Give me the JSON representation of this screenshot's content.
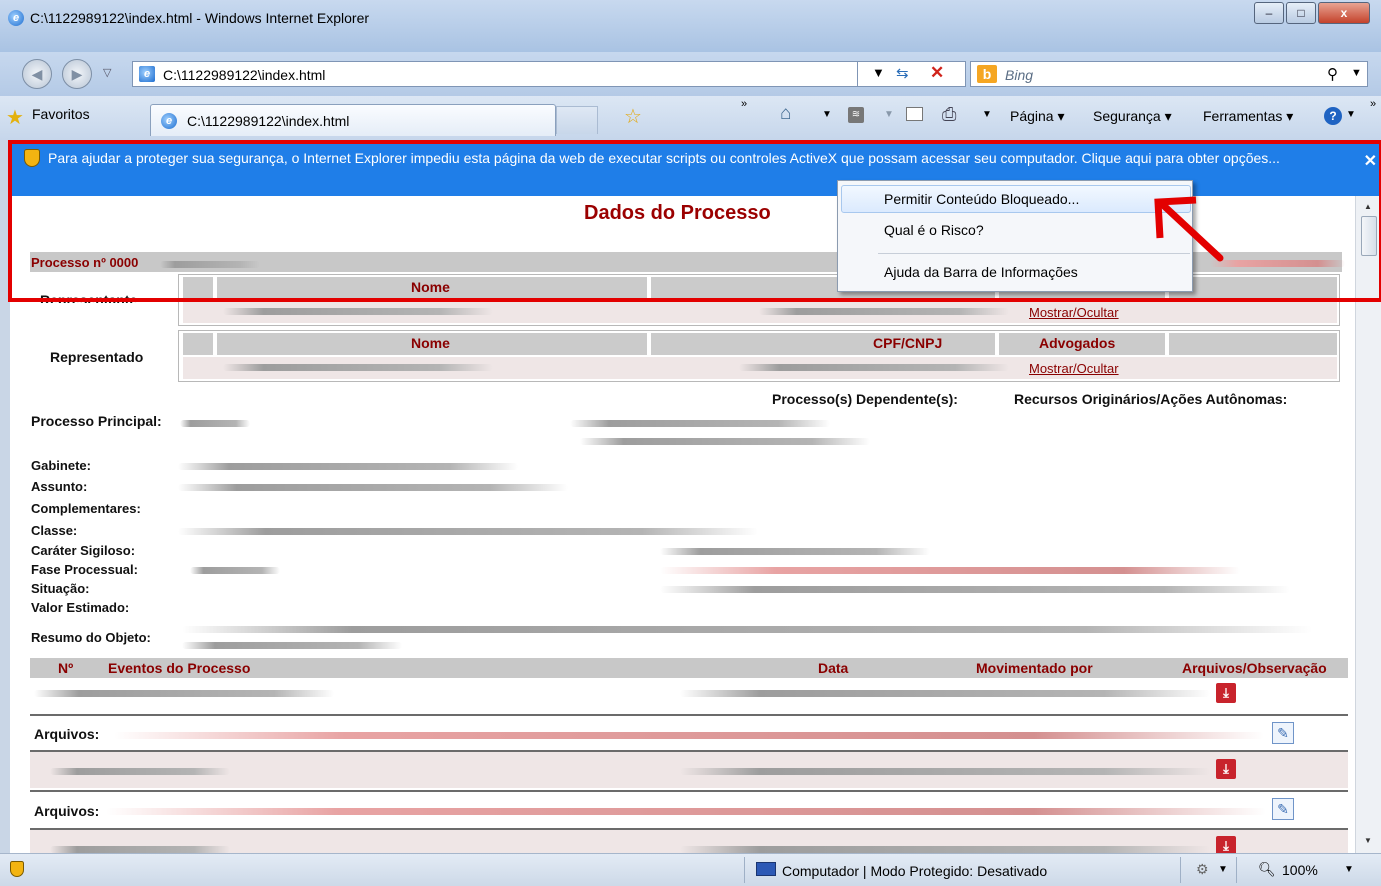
{
  "window": {
    "title": "C:\\1122989122\\index.html - Windows Internet Explorer",
    "minimize": "–",
    "maximize": "□",
    "close": "x"
  },
  "addressbar": {
    "url": "C:\\1122989122\\index.html",
    "search_placeholder": "Bing"
  },
  "favorites": {
    "label": "Favoritos"
  },
  "tab": {
    "label": "C:\\1122989122\\index.html"
  },
  "commandbar": {
    "pagina": "Página ▾",
    "seguranca": "Segurança ▾",
    "ferramentas": "Ferramentas ▾"
  },
  "infobar": {
    "message": "Para ajudar a proteger sua segurança, o Internet Explorer impediu esta página da web de executar scripts ou controles ActiveX que possam acessar seu computador. Clique aqui para obter opções..."
  },
  "context_menu": {
    "items": [
      "Permitir Conteúdo Bloqueado...",
      "Qual é o Risco?",
      "Ajuda da Barra de Informações"
    ]
  },
  "page": {
    "title": "Dados do Processo",
    "processo_label": "Processo nº 0000",
    "representante": "Representante",
    "representado": "Representado",
    "col_nome": "Nome",
    "col_cpf": "CPF/CNPJ",
    "col_advogados": "Advogados",
    "mostrar_ocultar": "Mostrar/Ocultar",
    "processos_dependentes": "Processo(s) Dependente(s):",
    "recursos": "Recursos Originários/Ações Autônomas:",
    "processo_principal": "Processo Principal:",
    "fields": [
      "Gabinete:",
      "Assunto:",
      "Complementares:",
      "Classe:",
      "Caráter Sigiloso:",
      "Fase Processual:",
      "Situação:",
      "Valor Estimado:",
      "Resumo do Objeto:"
    ],
    "events_header": {
      "num": "Nº",
      "eventos": "Eventos do Processo",
      "data": "Data",
      "movimentado": "Movimentado por",
      "arquivos": "Arquivos/Observação"
    },
    "arquivos_label": "Arquivos:"
  },
  "statusbar": {
    "zone": "Computador | Modo Protegido: Desativado",
    "zoom": "100%"
  }
}
